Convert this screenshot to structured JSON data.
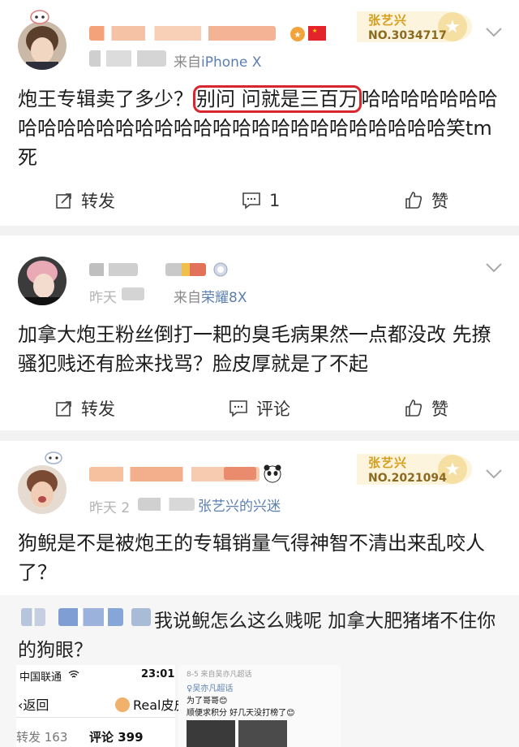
{
  "colors": {
    "accent": "#d8262f",
    "source_link": "#5b7fb0",
    "badge_gold": "#d69e1f",
    "page_bg": "#f2f2f2"
  },
  "posts": [
    {
      "source_prefix": "来自",
      "source": "iPhone X",
      "badge": {
        "name": "张艺兴",
        "number": "NO.3034717"
      },
      "text_before": "炮王专辑卖了多少？",
      "text_highlight": "别问 问就是三百万",
      "text_after": "哈哈哈哈哈哈哈哈哈哈哈哈哈哈哈哈哈哈哈哈哈哈哈哈哈哈哈哈哈笑tm死",
      "actions": {
        "repost": "转发",
        "comment": "1",
        "like": "赞"
      }
    },
    {
      "time": "昨天",
      "source_prefix": "来自",
      "source": "荣耀8X",
      "text": "加拿大炮王粉丝倒打一耙的臭毛病果然一点都没改 先撩骚犯贱还有脸来找骂？脸皮厚就是了不起",
      "actions": {
        "repost": "转发",
        "comment": "评论",
        "like": "赞"
      }
    },
    {
      "time": "昨天 2",
      "source": "张艺兴的兴迷",
      "badge": {
        "name": "张艺兴",
        "number": "NO.2021094"
      },
      "text": "狗鲵是不是被炮王的专辑销量气得神智不清出来乱咬人了？"
    }
  ],
  "repost": {
    "text": "我说鲵怎么这么贱呢 加拿大肥猪堵不住你的狗眼？",
    "screenshot": {
      "carrier": "中国联通",
      "time": "23:01",
      "back": "返回",
      "user": "Real皮皮",
      "reposts": "转发 163",
      "comments": "评论 399"
    },
    "screenshot2": {
      "line1": "8-5 来自吴亦凡超话",
      "line2": "♀吴亦凡超话",
      "line3": "为了哥哥😊",
      "line4": "顺便求积分 好几天没打榜了😊"
    }
  },
  "icons": [
    "avatar",
    "repost-icon",
    "comment-icon",
    "like-icon",
    "chevron-down-icon",
    "china-flag-icon",
    "panda-icon",
    "medal-icon",
    "wifi-icon"
  ]
}
